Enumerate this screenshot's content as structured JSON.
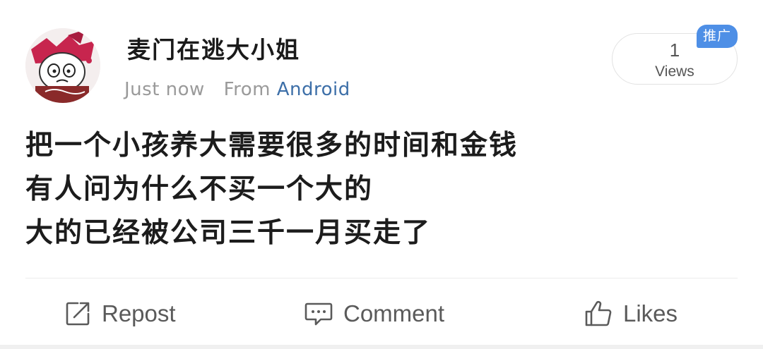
{
  "post": {
    "author": {
      "name": "麦门在逃大小姐"
    },
    "time": "Just now",
    "from_label": "From",
    "source": "Android",
    "views": {
      "count": "1",
      "label": "Views"
    },
    "promo_badge": "推广",
    "content_lines": [
      "把一个小孩养大需要很多的时间和金钱",
      "有人问为什么不买一个大的",
      "大的已经被公司三千一月买走了"
    ]
  },
  "actions": {
    "repost_label": "Repost",
    "comment_label": "Comment",
    "likes_label": "Likes"
  },
  "colors": {
    "source_link": "#3d6fa8",
    "promo_badge": "#4e8fe6",
    "avatar_accent": "#c7254e"
  }
}
